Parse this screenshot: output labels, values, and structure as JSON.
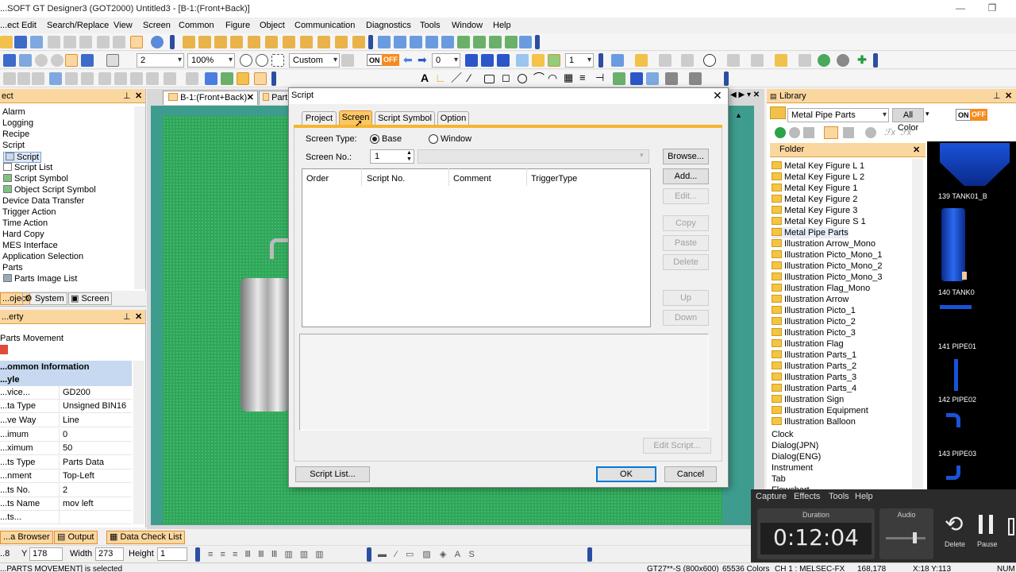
{
  "window": {
    "title": "...SOFT GT Designer3 (GOT2000) Untitled3 - [B-1:(Front+Back)]"
  },
  "menu": [
    "...ect",
    "Edit",
    "Search/Replace",
    "View",
    "Screen",
    "Common",
    "Figure",
    "Object",
    "Communication",
    "Diagnostics",
    "Tools",
    "Window",
    "Help"
  ],
  "toolbar": {
    "line_width": "2",
    "zoom": "100%",
    "custom": "Custom",
    "on": "ON",
    "off": "OFF",
    "state_value": "0",
    "pos_value": "1"
  },
  "doc_tabs": [
    {
      "label": "B-1:(Front+Back)"
    },
    {
      "label": "Part"
    }
  ],
  "project_tree": {
    "items": [
      "Alarm",
      "Logging",
      "Recipe",
      "Script",
      "Script",
      "Script List",
      "Script Symbol",
      "Object Script Symbol",
      "Device Data Transfer",
      "Trigger Action",
      "Time Action",
      "Hard Copy",
      "MES Interface",
      "Application Selection",
      "Parts",
      "Parts Image List"
    ],
    "bottom_tabs": [
      "...oject",
      "System",
      "Screen"
    ]
  },
  "property": {
    "title": "...erty",
    "object_name": "Parts Movement",
    "section": "...ommon Information",
    "subsection": "...yle",
    "rows": [
      {
        "k": "...vice...",
        "v": "GD200"
      },
      {
        "k": "...ta Type",
        "v": "Unsigned BIN16"
      },
      {
        "k": "...ve Way",
        "v": "Line"
      },
      {
        "k": "...imum",
        "v": "0"
      },
      {
        "k": "...ximum",
        "v": "50"
      },
      {
        "k": "...ts Type",
        "v": "Parts Data"
      },
      {
        "k": "...nment",
        "v": "Top-Left"
      },
      {
        "k": "...ts No.",
        "v": "2"
      },
      {
        "k": "...ts Name",
        "v": "mov left"
      },
      {
        "k": "...ts...",
        "v": ""
      }
    ]
  },
  "bottom_tabs": [
    "...a Browser",
    "Output",
    "Data Check List"
  ],
  "coords": {
    "y_label": "Y",
    "y": "178",
    "width_label": "Width",
    "width": "273",
    "height_label": "Height",
    "height": "1",
    "x": "..8"
  },
  "dialog": {
    "title": "Script",
    "tabs": [
      "Project",
      "Screen",
      "Script Symbol",
      "Option"
    ],
    "screen_type_label": "Screen Type:",
    "base": "Base",
    "window": "Window",
    "screen_no_label": "Screen No.:",
    "screen_no": "1",
    "columns": [
      "Order",
      "Script No.",
      "Comment",
      "TriggerType"
    ],
    "buttons": {
      "browse": "Browse...",
      "add": "Add...",
      "edit": "Edit...",
      "copy": "Copy",
      "paste": "Paste",
      "delete": "Delete",
      "up": "Up",
      "down": "Down",
      "edit_script": "Edit Script...",
      "script_list": "Script List...",
      "ok": "OK",
      "cancel": "Cancel"
    }
  },
  "library": {
    "title": "Library",
    "selected": "Metal Pipe Parts",
    "all_color": "All Color",
    "on": "ON",
    "off": "OFF",
    "folder_title": "Folder",
    "folders": [
      "Metal Key Figure L 1",
      "Metal Key Figure L 2",
      "Metal Key Figure 1",
      "Metal Key Figure 2",
      "Metal Key Figure 3",
      "Metal Key Figure S 1",
      "Metal Pipe Parts",
      "Illustration Arrow_Mono",
      "Illustration Picto_Mono_1",
      "Illustration Picto_Mono_2",
      "Illustration Picto_Mono_3",
      "Illustration Flag_Mono",
      "Illustration Arrow",
      "Illustration Picto_1",
      "Illustration Picto_2",
      "Illustration Picto_3",
      "Illustration Flag",
      "Illustration Parts_1",
      "Illustration Parts_2",
      "Illustration Parts_3",
      "Illustration Parts_4",
      "Illustration Sign",
      "Illustration Equipment",
      "Illustration Balloon"
    ],
    "roots": [
      "Clock",
      "Dialog(JPN)",
      "Dialog(ENG)",
      "Instrument",
      "Tab",
      "Flowchart"
    ],
    "thumbs": [
      "139 TANK01_B",
      "140 TANK0",
      "141 PIPE01",
      "142 PIPE02",
      "143 PIPE03"
    ]
  },
  "recorder": {
    "menu": [
      "Capture",
      "Effects",
      "Tools",
      "Help"
    ],
    "duration_label": "Duration",
    "time": "0:12:04",
    "audio_label": "Audio",
    "delete": "Delete",
    "pause": "Pause"
  },
  "status": {
    "left": "...PARTS MOVEMENT] is selected",
    "got": "GT27**-S (800x600)",
    "colors": "65536 Colors",
    "ch": "CH 1 : MELSEC-FX",
    "pos": "168,178",
    "xy": "X:18 Y:113",
    "num": "NUM"
  },
  "colors": {
    "accent": "#fbd7a0",
    "canvas_outer": "#3d9c8e",
    "canvas": "#2fa65a",
    "sep": "#2c4ea1"
  }
}
